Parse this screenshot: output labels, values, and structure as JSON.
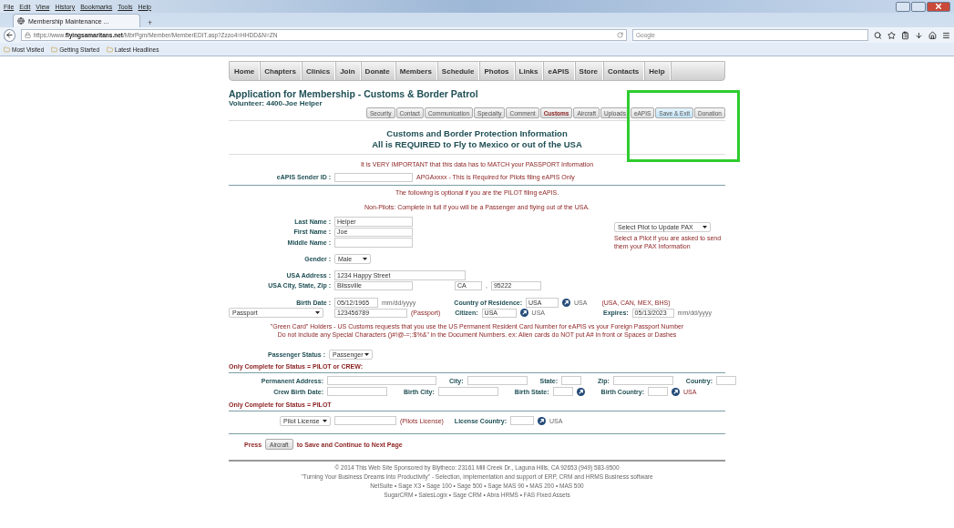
{
  "browser": {
    "menu": [
      "File",
      "Edit",
      "View",
      "History",
      "Bookmarks",
      "Tools",
      "Help"
    ],
    "tab_title": "Membership Maintenance ...",
    "new_tab": "+",
    "url": "https://www.**flyingsamaritans.net**/MbrPgm/Member/MemberEDIT.asp?Zzzo4=HHDD&N=ZN",
    "search_placeholder": "Google",
    "bookmarks": [
      "Most Visited",
      "Getting Started",
      "Latest Headlines"
    ]
  },
  "nav": [
    "Home",
    "Chapters",
    "Clinics",
    "Join",
    "Donate",
    "Members",
    "Schedule",
    "Photos",
    "Links",
    "eAPIS",
    "Store",
    "Contacts",
    "Help"
  ],
  "page_title": "Application for Membership - Customs & Border Patrol",
  "volunteer": "Volunteer: 4400-Joe Helper",
  "section_tabs": [
    {
      "label": "Security",
      "selected": false,
      "hovered": false
    },
    {
      "label": "Contact",
      "selected": false,
      "hovered": false
    },
    {
      "label": "Communication",
      "selected": false,
      "hovered": false
    },
    {
      "label": "Specialty",
      "selected": false,
      "hovered": false
    },
    {
      "label": "Comment",
      "selected": false,
      "hovered": false
    },
    {
      "label": "Customs",
      "selected": true,
      "hovered": false
    },
    {
      "label": "Aircraft",
      "selected": false,
      "hovered": false
    },
    {
      "label": "Uploads",
      "selected": false,
      "hovered": false
    },
    {
      "label": "eAPIS",
      "selected": false,
      "hovered": false
    },
    {
      "label": "Save & Exit",
      "selected": false,
      "hovered": true
    },
    {
      "label": "Donation",
      "selected": false,
      "hovered": false
    }
  ],
  "heading": [
    "Customs and Border Protection Information",
    "All is REQUIRED to Fly to Mexico or out of the USA"
  ],
  "important_note": "It is VERY IMPORTANT that this data has to MATCH your PASSPORT Information",
  "sender_id": {
    "label": "eAPIS Sender ID :",
    "hint": "APGAxxxx  - This is Required for Pilots filing eAPIS Only"
  },
  "optional_note": "The following is optional if you are the PILOT filing eAPIS.",
  "non_pilot_note": "Non-Pilots:  Complete in full if you will be a Passenger and flying out of the USA.",
  "names": [
    {
      "label": "Last Name :",
      "value": "Helper"
    },
    {
      "label": "First Name :",
      "value": "Joe"
    },
    {
      "label": "Middle Name :"
    }
  ],
  "pilot_select": {
    "value": "Select Pilot to Update PAX",
    "hint": "Select a Pilot if you are asked to send them your PAX Information"
  },
  "gender": {
    "label": "Gender :",
    "value": "Male"
  },
  "address": {
    "label": "USA Address :",
    "value": "1234 Happy Street"
  },
  "city_row": {
    "label": "USA City, State, Zip :",
    "city": "Blissville",
    "state": "CA",
    "separator": ",",
    "zip": "95222"
  },
  "birth": {
    "label": "Birth Date  :",
    "value": "05/12/1965",
    "format": "mm/dd/yyyy"
  },
  "residence": {
    "label": "Country of Residence:",
    "value": "USA",
    "lookup": "USA",
    "options": "(USA, CAN, MEX, BHS)"
  },
  "document": {
    "type": "Passport",
    "number": "123456789",
    "note": "(Passport)"
  },
  "citizen": {
    "label": "Citizen:",
    "value": "USA",
    "lookup": "USA"
  },
  "expires": {
    "label": "Expires:",
    "value": "05/13/2023",
    "format": "mm/dd/yyyy"
  },
  "green_card_note": [
    "\"Green Card\" Holders - US Customs requests that you use the US Permanent Resident Card Number for eAPIS vs your Foreign Passport Number",
    "Do not include any Special Characters ()#!@-=;:$%&\" in the Document Numbers.  ex:  Alien cards do NOT put A# in front or Spaces or Dashes"
  ],
  "passenger_status": {
    "label": "Passenger Status :",
    "value": "Passenger"
  },
  "crew_section": {
    "title": "Only Complete for Status =  PILOT or CREW:",
    "rows": [
      [
        {
          "label": "Permanent Address:",
          "kind": "wide"
        },
        {
          "label": "City:",
          "kind": "medium"
        },
        {
          "label": "State:",
          "kind": "code"
        },
        {
          "label": "Zip:",
          "kind": "medium"
        },
        {
          "label": "Country:",
          "kind": "code"
        }
      ],
      [
        {
          "label": "Crew Birth Date:",
          "kind": "medium"
        },
        {
          "label": "Birth City:",
          "kind": "medium"
        },
        {
          "label": "Birth State:",
          "kind": "code"
        },
        {
          "label": "Birth Country:",
          "kind": "code",
          "note": "USA"
        }
      ]
    ]
  },
  "pilot_section": {
    "title": "Only Complete for Status = PILOT",
    "license_type": "Pilot License",
    "note": "(Pilots License)",
    "country_label": "License Country:",
    "country_note": "USA"
  },
  "continue": {
    "before": "Press",
    "button": "Aircraft",
    "after": "to Save and Continue to Next Page"
  },
  "footer": [
    "© 2014 This Web Site  Sponsored by Blytheco: 23161 Mill Creek Dr., Laguna Hills, CA 92653   (949) 583-9500",
    "\"Turning Your Business Dreams into Productivity\" - Selection, implementation and support of ERP, CRM and HRMS Business software",
    "NetSuite  •  Sage X3  •  Sage 100  •  Sage 500  •  Sage MAS 90  •  MAS 200  •  MAS 500",
    "SugarCRM  •  SalesLogix  •  Sage CRM  •  Abra HRMS  •  FAS Fixed Assets"
  ]
}
